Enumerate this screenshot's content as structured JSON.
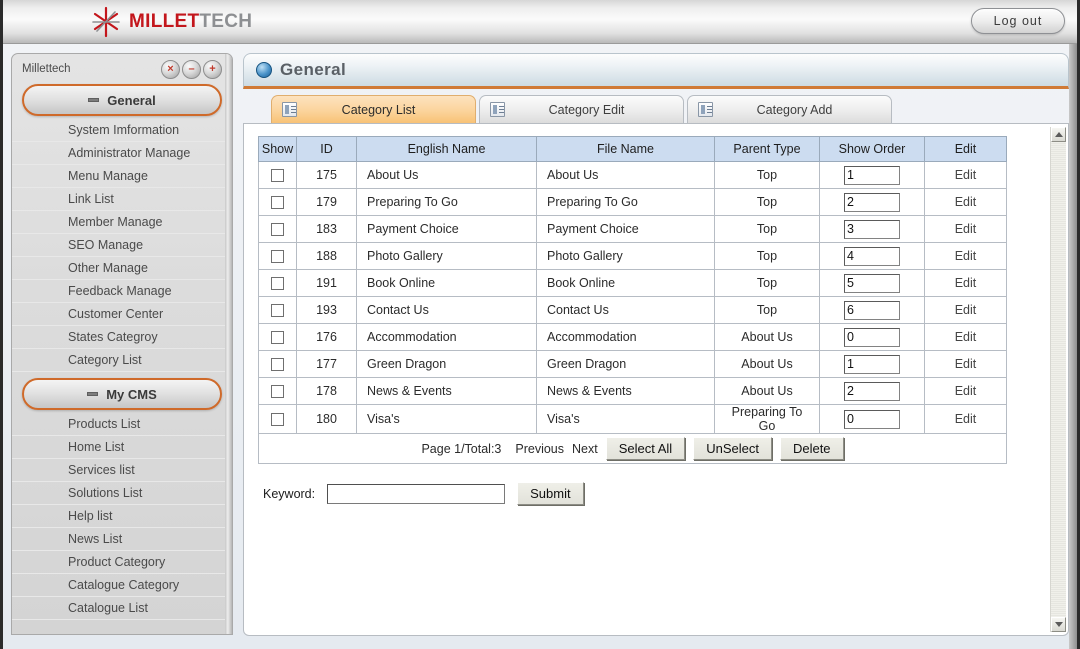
{
  "banner": {
    "logo_red": "MILLET",
    "logo_gray": "TECH",
    "logo_icon": "star-burst-icon",
    "logout_label": "Log  out"
  },
  "sidebar": {
    "title": "Millettech",
    "controls": [
      {
        "name": "close-icon",
        "glyph": "×"
      },
      {
        "name": "minimize-icon",
        "glyph": "–"
      },
      {
        "name": "expand-icon",
        "glyph": "+"
      }
    ],
    "groups": [
      {
        "label": "General",
        "items": [
          "System Imformation",
          "Administrator Manage",
          "Menu Manage",
          "Link List",
          "Member Manage",
          "SEO Manage",
          "Other Manage",
          "Feedback Manage",
          "Customer Center",
          "States Categroy",
          "Category List"
        ]
      },
      {
        "label": "My CMS",
        "items": [
          "Products List",
          "Home List",
          "Services list",
          "Solutions List",
          "Help list",
          "News List",
          "Product Category",
          "Catalogue Category",
          "Catalogue List"
        ]
      }
    ]
  },
  "main": {
    "panel_title": "General",
    "panel_icon": "globe-icon",
    "tabs": [
      {
        "label": "Category List",
        "active": true
      },
      {
        "label": "Category Edit",
        "active": false
      },
      {
        "label": "Category Add",
        "active": false
      }
    ],
    "table": {
      "headers": [
        "Show",
        "ID",
        "English Name",
        "File Name",
        "Parent Type",
        "Show Order",
        "Edit"
      ],
      "rows": [
        {
          "id": "175",
          "english_name": "About Us",
          "file_name": "About Us",
          "parent_type": "Top",
          "show_order": "1",
          "edit": "Edit"
        },
        {
          "id": "179",
          "english_name": "Preparing To Go",
          "file_name": "Preparing To Go",
          "parent_type": "Top",
          "show_order": "2",
          "edit": "Edit"
        },
        {
          "id": "183",
          "english_name": "Payment Choice",
          "file_name": "Payment Choice",
          "parent_type": "Top",
          "show_order": "3",
          "edit": "Edit"
        },
        {
          "id": "188",
          "english_name": "Photo Gallery",
          "file_name": "Photo Gallery",
          "parent_type": "Top",
          "show_order": "4",
          "edit": "Edit"
        },
        {
          "id": "191",
          "english_name": "Book Online",
          "file_name": "Book Online",
          "parent_type": "Top",
          "show_order": "5",
          "edit": "Edit"
        },
        {
          "id": "193",
          "english_name": "Contact Us",
          "file_name": "Contact Us",
          "parent_type": "Top",
          "show_order": "6",
          "edit": "Edit"
        },
        {
          "id": "176",
          "english_name": "Accommodation",
          "file_name": "Accommodation",
          "parent_type": "About Us",
          "show_order": "0",
          "edit": "Edit"
        },
        {
          "id": "177",
          "english_name": "Green Dragon",
          "file_name": "Green Dragon",
          "parent_type": "About Us",
          "show_order": "1",
          "edit": "Edit"
        },
        {
          "id": "178",
          "english_name": "News & Events",
          "file_name": "News & Events",
          "parent_type": "About Us",
          "show_order": "2",
          "edit": "Edit"
        },
        {
          "id": "180",
          "english_name": "Visa's",
          "file_name": "Visa's",
          "parent_type": "Preparing To Go",
          "show_order": "0",
          "edit": "Edit"
        }
      ],
      "footer": {
        "page_text": "Page 1/Total:3",
        "previous_label": "Previous",
        "next_label": "Next",
        "select_all_label": "Select All",
        "unselect_label": "UnSelect",
        "delete_label": "Delete"
      }
    },
    "search": {
      "label": "Keyword:",
      "value": "",
      "placeholder": "",
      "submit_label": "Submit"
    }
  },
  "colors": {
    "accent_orange": "#d07a36",
    "tab_active": "#f8c276",
    "header_blue": "#ccdcf0",
    "logo_red": "#c3161c"
  }
}
